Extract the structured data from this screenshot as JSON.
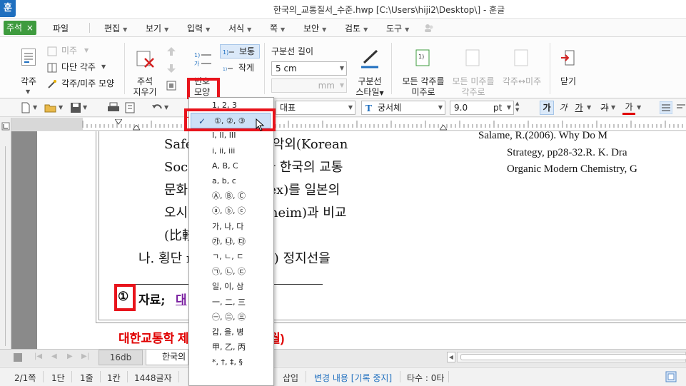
{
  "window": {
    "app_icon": "훈",
    "title": "한국의_교통질서_수준.hwp [C:\\Users\\hiji2\\Desktop\\] - 훈글"
  },
  "menubar": {
    "memo_tab": "주석",
    "memo_close": "×",
    "items": [
      "파일",
      "편집",
      "보기",
      "입력",
      "서식",
      "쪽",
      "보안",
      "검토",
      "도구"
    ]
  },
  "ribbon": {
    "footnote": "각주",
    "endnote": "미주",
    "multi_footnote": "다단 각주",
    "footnote_shape": "각주/미주 모양",
    "delete_note_1": "주석",
    "delete_note_2": "지우기",
    "number_shape_1": "번호",
    "number_shape_2": "모양",
    "normal": "보통",
    "small": "작게",
    "separator_length_label": "구분선 길이",
    "separator_length_value": "5 cm",
    "separator_unit": "mm",
    "separator_style_1": "구분선",
    "separator_style_2": "스타일",
    "fn_to_en_1": "모든 각주를",
    "fn_to_en_2": "미주로",
    "en_to_fn_1": "모든 미주를",
    "en_to_fn_2": "각주로",
    "swap": "각주↔미주",
    "close": "닫기"
  },
  "format_bar": {
    "style": "대표",
    "font": "궁서체",
    "font_size": "9.0",
    "unit": "pt",
    "bold_btn": "가",
    "italic_btn": "가",
    "underline_btn": "가",
    "strike_btn": "가",
    "color_btn": "가"
  },
  "document": {
    "lines": [
      "Safe         y)과  내한교통악외(Korean",
      "Soc         sportation)가 한국의 교통",
      "문화            -culture  Index)를  일본의",
      "오시            만하임(Mannheim)과  비교",
      "(比較           發表)하였다.",
      "나. 횡단          rian    Crossing)  정지선을"
    ],
    "footnote_mark": "①",
    "footnote_label": "자료;",
    "footnote_tail": "대",
    "refs": [
      "Salame,   R.(2006).   Why   Do   M",
      "Strategy,  pp28-32.R.  K.  Dra",
      "Organic Modern Chemistry, G"
    ],
    "red_footer": "대한교통학           제8호 (2020년 10월)"
  },
  "tabs": {
    "tab1": "16db",
    "tab2": "한국의_"
  },
  "status": {
    "page": "2/1쪽",
    "column": "1단",
    "line": "1줄",
    "col": "1칸",
    "chars": "1448글자",
    "insert": "삽입",
    "track": "변경 내용 [기록 중지]",
    "keys": "타수 : 0타"
  },
  "dropdown": {
    "check": "✓",
    "items": [
      "1, 2, 3",
      "①, ②, ③",
      "I, II, III",
      "i, ii, iii",
      "A, B, C",
      "a, b, c",
      "Ⓐ, Ⓑ, Ⓒ",
      "ⓐ, ⓑ, ⓒ",
      "가, 나, 다",
      "㉮, ㉯, ㉰",
      "ㄱ, ㄴ, ㄷ",
      "㉠, ㉡, ㉢",
      "일, 이, 삼",
      "一, 二, 三",
      "㊀, ㊁, ㊂",
      "갑, 을, 병",
      "甲, 乙, 丙",
      "*, †, ‡, §"
    ]
  },
  "colors": {
    "highlight_red": "#e8141c",
    "memo_green": "#3e9b3e",
    "app_blue": "#1f6fbf",
    "footer_red": "#e00000"
  }
}
